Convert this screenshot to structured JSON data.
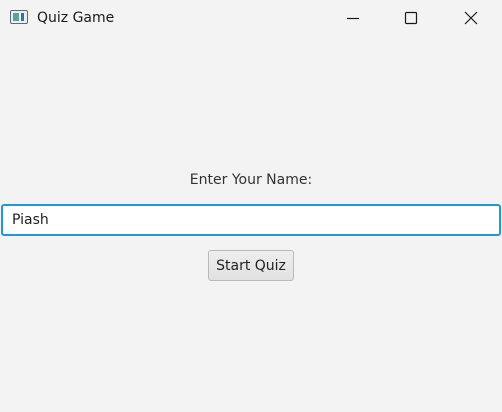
{
  "window": {
    "title": "Quiz Game",
    "controls": {
      "minimize": "minimize-icon",
      "maximize": "maximize-icon",
      "close": "close-icon"
    }
  },
  "form": {
    "prompt": "Enter Your Name:",
    "name_value": "Piash",
    "start_button": "Start Quiz"
  },
  "colors": {
    "background": "#f3f3f3",
    "input_focus_border": "#1e9bd7"
  }
}
